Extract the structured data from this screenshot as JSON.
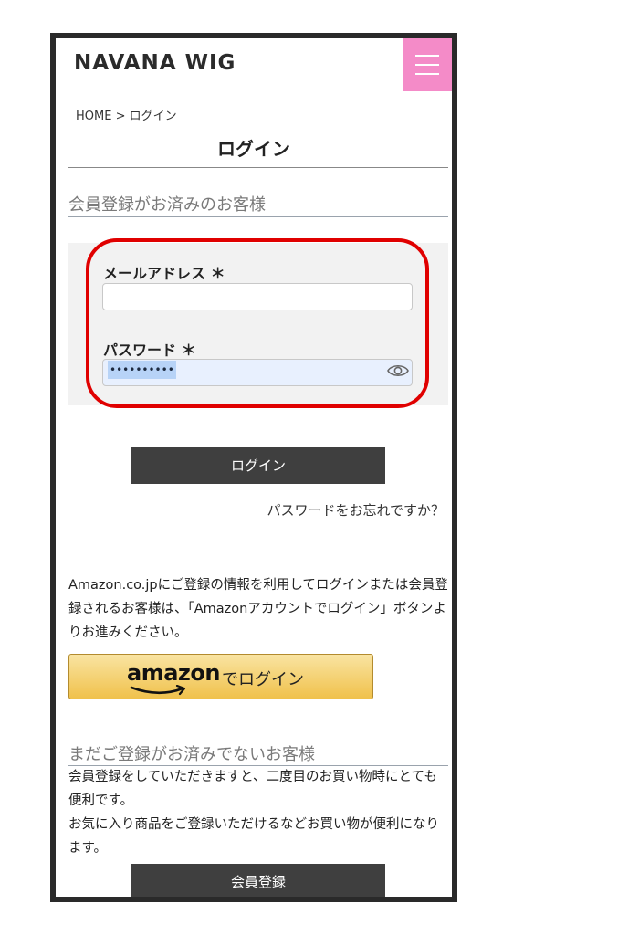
{
  "header": {
    "logo": "NAVANA WIG",
    "menu_icon": "hamburger-menu-icon",
    "menu_color": "#f48bc8"
  },
  "breadcrumb": "HOME > ログイン",
  "page_title": "ログイン",
  "member_section": {
    "heading": "会員登録がお済みのお客様",
    "email_label": "メールアドレス ＊",
    "email_value": "",
    "password_label": "パスワード ＊",
    "password_mask": "••••••••••",
    "eye_icon": "eye-icon"
  },
  "login_button": "ログイン",
  "forgot_link": "パスワードをお忘れですか？",
  "amazon": {
    "description": "Amazon.co.jpにご登録の情報を利用してログインまたは会員登録されるお客様は、「Amazonアカウントでログイン」ボタンよりお進みください。",
    "logo_text": "amazon",
    "button_label": "でログイン"
  },
  "register_section": {
    "heading": "まだご登録がお済みでないお客様",
    "text1": "会員登録をしていただきますと、二度目のお買い物時にとても便利です。",
    "text2": "お気に入り商品をご登録いただけるなどお買い物が便利になります。",
    "button_label": "会員登録"
  },
  "colors": {
    "highlight_ring": "#e00000",
    "dark_button": "#3f3f3f",
    "amazon_button": "#f0c14b"
  }
}
